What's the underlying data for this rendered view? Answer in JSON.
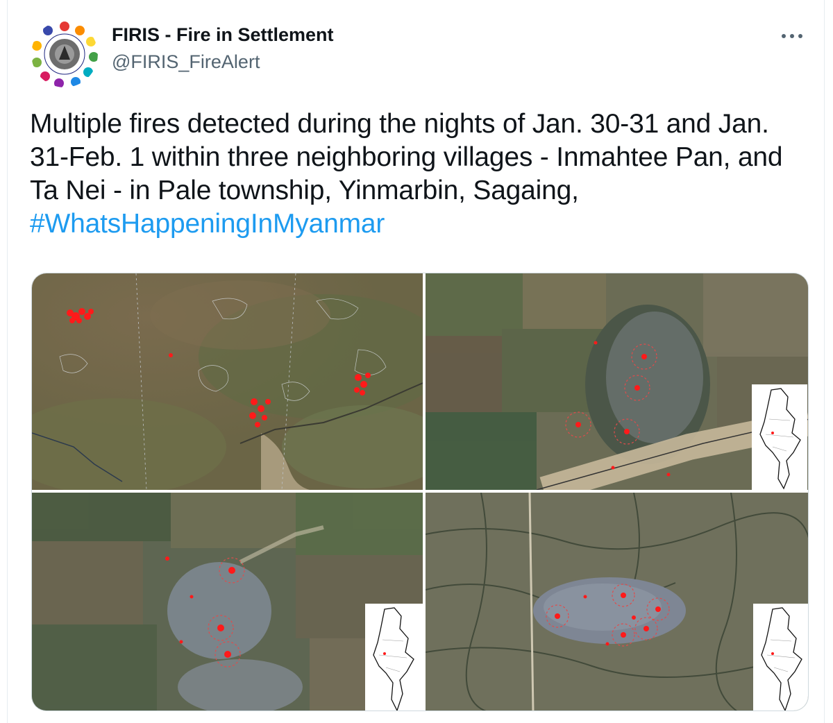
{
  "author": {
    "display_name": "FIRIS - Fire in Settlement",
    "handle": "@FIRIS_FireAlert",
    "avatar_text": "FIRIS - Fire in Settlement"
  },
  "more_menu": {
    "icon": "more-horizontal-icon",
    "label": "···"
  },
  "tweet": {
    "text_part1": "Multiple fires detected during the nights of Jan. 30-31 and Jan. 31-Feb. 1 within three neighboring villages - Inmahtee Pan, and Ta Nei - in Pale township, Yinmarbin, Sagaing, ",
    "hashtag": "#WhatsHappeningInMyanmar"
  },
  "media": [
    {
      "name": "overview-satellite-map",
      "icons": [
        "fire-hotspot-marker"
      ]
    },
    {
      "name": "village-satellite-map-1",
      "icons": [
        "fire-hotspot-marker",
        "myanmar-locator-map"
      ]
    },
    {
      "name": "village-satellite-map-2",
      "icons": [
        "fire-hotspot-marker",
        "myanmar-locator-map"
      ]
    },
    {
      "name": "village-satellite-map-3",
      "icons": [
        "fire-hotspot-marker",
        "myanmar-locator-map"
      ]
    }
  ],
  "colors": {
    "text": "#0f1419",
    "secondary": "#536471",
    "link": "#1d9bf0",
    "fire_marker": "#ff1a1a"
  }
}
